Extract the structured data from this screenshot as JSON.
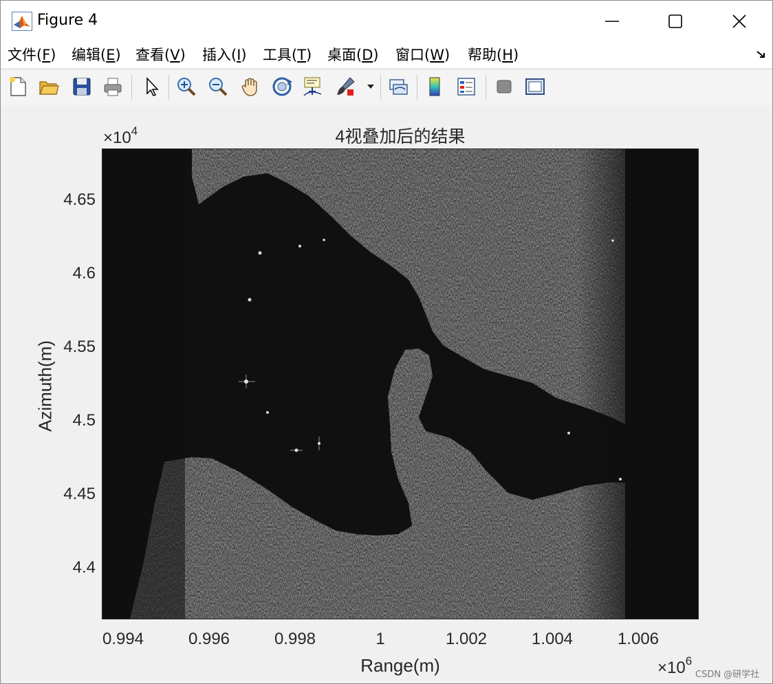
{
  "window": {
    "title": "Figure 4",
    "controls": {
      "minimize": "minimize",
      "maximize": "maximize",
      "close": "close"
    }
  },
  "menubar": {
    "items": [
      {
        "label": "文件(",
        "key": "F",
        "end": ")"
      },
      {
        "label": "编辑(",
        "key": "E",
        "end": ")"
      },
      {
        "label": "查看(",
        "key": "V",
        "end": ")"
      },
      {
        "label": "插入(",
        "key": "I",
        "end": ")"
      },
      {
        "label": "工具(",
        "key": "T",
        "end": ")"
      },
      {
        "label": "桌面(",
        "key": "D",
        "end": ")"
      },
      {
        "label": "窗口(",
        "key": "W",
        "end": ")"
      },
      {
        "label": "帮助(",
        "key": "H",
        "end": ")"
      }
    ]
  },
  "toolbar": {
    "icons": [
      "new-figure-icon",
      "open-file-icon",
      "save-icon",
      "print-icon",
      "pointer-icon",
      "zoom-in-icon",
      "zoom-out-icon",
      "pan-hand-icon",
      "rotate-3d-icon",
      "data-cursor-icon",
      "brush-icon",
      "link-plot-icon",
      "colorbar-icon",
      "legend-icon",
      "hide-plot-tools-icon",
      "show-plot-tools-icon"
    ]
  },
  "chart_data": {
    "type": "heatmap",
    "title": "4视叠加后的结果",
    "xlabel": "Range(m)",
    "ylabel": "Azimuth(m)",
    "x_exponent": "×10",
    "x_exponent_power": "6",
    "y_exponent": "×10",
    "y_exponent_power": "4",
    "xticks": [
      "0.994",
      "0.996",
      "0.998",
      "1",
      "1.002",
      "1.004",
      "1.006"
    ],
    "yticks": [
      "4.65",
      "4.6",
      "4.55",
      "4.5",
      "4.45",
      "4.4"
    ],
    "xlim": [
      0.99335,
      1.00745
    ],
    "ylim": [
      4.3665,
      4.6855
    ],
    "colormap": "gray",
    "grid": false
  },
  "watermark": "CSDN @研学社"
}
